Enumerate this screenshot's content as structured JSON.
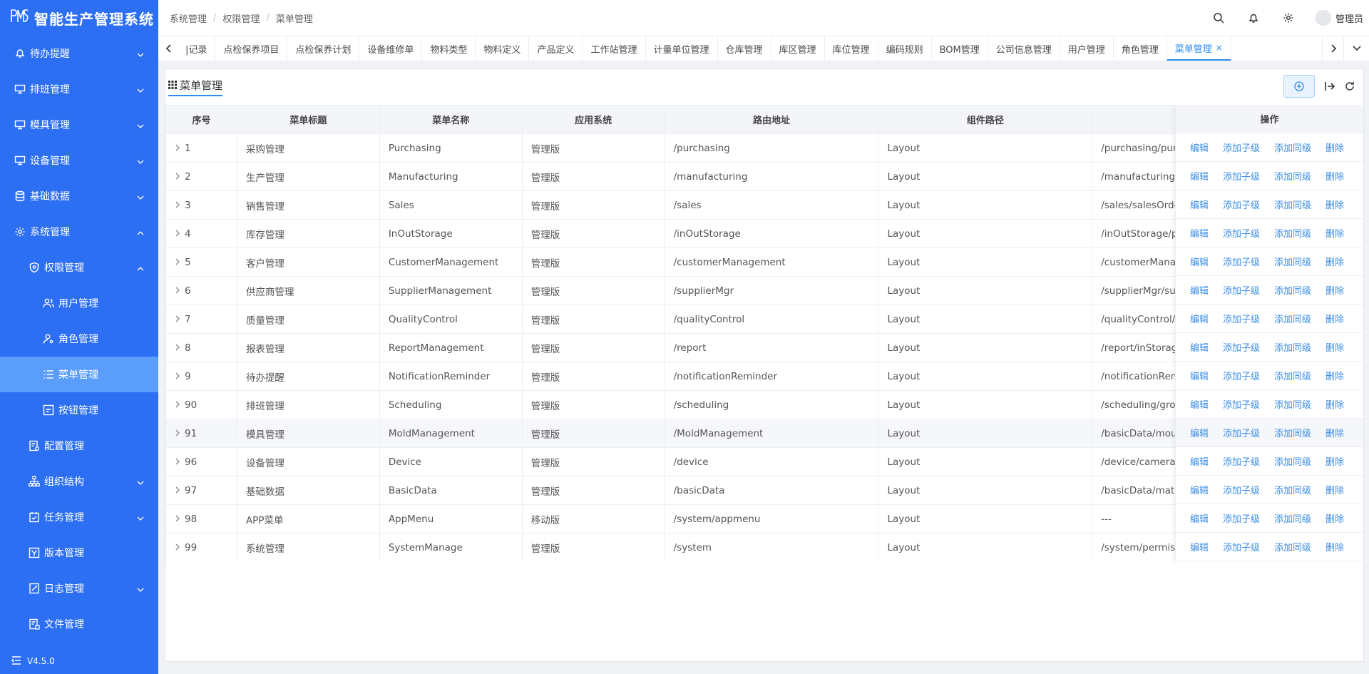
{
  "app": {
    "logo_mark": "PMS",
    "title": "智能生产管理系统",
    "version": "V4.5.0"
  },
  "sidebar": {
    "items": [
      {
        "label": "待办提醒",
        "icon": "bell-icon",
        "level": 1,
        "expandable": true,
        "expanded": false
      },
      {
        "label": "排班管理",
        "icon": "monitor-icon",
        "level": 1,
        "expandable": true,
        "expanded": false
      },
      {
        "label": "模具管理",
        "icon": "monitor-icon",
        "level": 1,
        "expandable": true,
        "expanded": false
      },
      {
        "label": "设备管理",
        "icon": "monitor-icon",
        "level": 1,
        "expandable": true,
        "expanded": false
      },
      {
        "label": "基础数据",
        "icon": "database-icon",
        "level": 1,
        "expandable": true,
        "expanded": false
      },
      {
        "label": "系统管理",
        "icon": "gear-icon",
        "level": 1,
        "expandable": true,
        "expanded": true
      },
      {
        "label": "权限管理",
        "icon": "shield-icon",
        "level": 2,
        "expandable": true,
        "expanded": true
      },
      {
        "label": "用户管理",
        "icon": "users-icon",
        "level": 3,
        "expandable": false
      },
      {
        "label": "角色管理",
        "icon": "user-gear-icon",
        "level": 3,
        "expandable": false
      },
      {
        "label": "菜单管理",
        "icon": "list-icon",
        "level": 3,
        "expandable": false,
        "active": true
      },
      {
        "label": "按钮管理",
        "icon": "button-icon",
        "level": 3,
        "expandable": false
      },
      {
        "label": "配置管理",
        "icon": "config-icon",
        "level": 2,
        "expandable": false
      },
      {
        "label": "组织结构",
        "icon": "org-icon",
        "level": 2,
        "expandable": true,
        "expanded": false
      },
      {
        "label": "任务管理",
        "icon": "task-icon",
        "level": 2,
        "expandable": true,
        "expanded": false
      },
      {
        "label": "版本管理",
        "icon": "version-icon",
        "level": 2,
        "expandable": false
      },
      {
        "label": "日志管理",
        "icon": "log-icon",
        "level": 2,
        "expandable": true,
        "expanded": false
      },
      {
        "label": "文件管理",
        "icon": "file-icon",
        "level": 2,
        "expandable": false
      }
    ]
  },
  "header": {
    "breadcrumb": [
      "系统管理",
      "权限管理",
      "菜单管理"
    ],
    "user_name": "管理员"
  },
  "tabs": {
    "items": [
      "|记录",
      "点检保养项目",
      "点检保养计划",
      "设备维修单",
      "物料类型",
      "物料定义",
      "产品定义",
      "工作站管理",
      "计量单位管理",
      "仓库管理",
      "库区管理",
      "库位管理",
      "编码规则",
      "BOM管理",
      "公司信息管理",
      "用户管理",
      "角色管理",
      "菜单管理"
    ],
    "active": "菜单管理",
    "close_glyph": "×"
  },
  "page": {
    "title": "菜单管理"
  },
  "table": {
    "columns": [
      "序号",
      "菜单标题",
      "菜单名称",
      "应用系统",
      "路由地址",
      "组件路径",
      ""
    ],
    "ops_header": "操作",
    "ops": [
      "编辑",
      "添加子级",
      "添加同级",
      "删除"
    ],
    "rows": [
      {
        "id": "1",
        "title": "采购管理",
        "name": "Purchasing",
        "system": "管理版",
        "route": "/purchasing",
        "component": "Layout",
        "redirect": "/purchasing/purch"
      },
      {
        "id": "2",
        "title": "生产管理",
        "name": "Manufacturing",
        "system": "管理版",
        "route": "/manufacturing",
        "component": "Layout",
        "redirect": "/manufacturing/pr"
      },
      {
        "id": "3",
        "title": "销售管理",
        "name": "Sales",
        "system": "管理版",
        "route": "/sales",
        "component": "Layout",
        "redirect": "/sales/salesOrde"
      },
      {
        "id": "4",
        "title": "库存管理",
        "name": "InOutStorage",
        "system": "管理版",
        "route": "/inOutStorage",
        "component": "Layout",
        "redirect": "/inOutStorage/pro"
      },
      {
        "id": "5",
        "title": "客户管理",
        "name": "CustomerManagement",
        "system": "管理版",
        "route": "/customerManagement",
        "component": "Layout",
        "redirect": "/customerManage"
      },
      {
        "id": "6",
        "title": "供应商管理",
        "name": "SupplierManagement",
        "system": "管理版",
        "route": "/supplierMgr",
        "component": "Layout",
        "redirect": "/supplierMgr/supp"
      },
      {
        "id": "7",
        "title": "质量管理",
        "name": "QualityControl",
        "system": "管理版",
        "route": "/qualityControl",
        "component": "Layout",
        "redirect": "/qualityControl/de"
      },
      {
        "id": "8",
        "title": "报表管理",
        "name": "ReportManagement",
        "system": "管理版",
        "route": "/report",
        "component": "Layout",
        "redirect": "/report/inStorage"
      },
      {
        "id": "9",
        "title": "待办提醒",
        "name": "NotificationReminder",
        "system": "管理版",
        "route": "/notificationReminder",
        "component": "Layout",
        "redirect": "/notificationRemin"
      },
      {
        "id": "90",
        "title": "排班管理",
        "name": "Scheduling",
        "system": "管理版",
        "route": "/scheduling",
        "component": "Layout",
        "redirect": "/scheduling/group"
      },
      {
        "id": "91",
        "title": "模具管理",
        "name": "MoldManagement",
        "system": "管理版",
        "route": "/MoldManagement",
        "component": "Layout",
        "redirect": "/basicData/mould"
      },
      {
        "id": "96",
        "title": "设备管理",
        "name": "Device",
        "system": "管理版",
        "route": "/device",
        "component": "Layout",
        "redirect": "/device/camera"
      },
      {
        "id": "97",
        "title": "基础数据",
        "name": "BasicData",
        "system": "管理版",
        "route": "/basicData",
        "component": "Layout",
        "redirect": "/basicData/mater"
      },
      {
        "id": "98",
        "title": "APP菜单",
        "name": "AppMenu",
        "system": "移动版",
        "route": "/system/appmenu",
        "component": "Layout",
        "redirect": "---"
      },
      {
        "id": "99",
        "title": "系统管理",
        "name": "SystemManage",
        "system": "管理版",
        "route": "/system",
        "component": "Layout",
        "redirect": "/system/permissi"
      }
    ],
    "highlighted_row": "91"
  },
  "colors": {
    "sidebar_bg": "#2d6ff2",
    "sidebar_active": "#5b9dfa",
    "accent": "#2d8cf0",
    "link": "#3a8ee6"
  }
}
